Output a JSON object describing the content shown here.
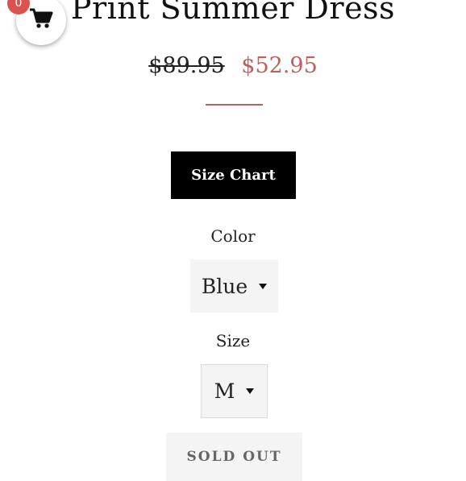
{
  "product": {
    "title": "Print Summer Dress",
    "price_original": "$89.95",
    "price_sale": "$52.95"
  },
  "cart": {
    "count": "0",
    "icon": "cart-icon"
  },
  "size_chart": {
    "label": "Size Chart"
  },
  "color": {
    "label": "Color",
    "selected": "Blue"
  },
  "size": {
    "label": "Size",
    "selected": "M"
  },
  "sold_out": {
    "label": "SOLD OUT"
  },
  "colors": {
    "sale": "#c0605d",
    "badge": "#d9534f",
    "button": "#000000"
  }
}
